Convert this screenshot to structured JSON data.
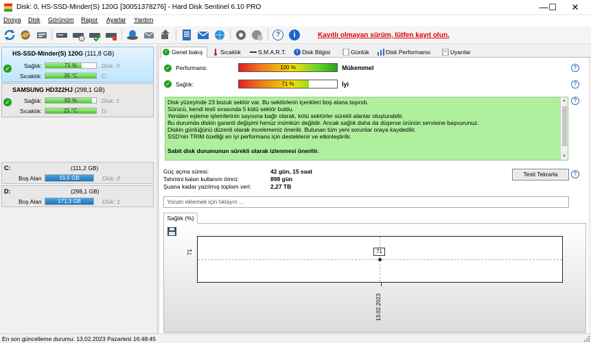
{
  "window": {
    "title": "Disk: 0, HS-SSD-Minder(S) 120G [30051378276]  -  Hard Disk Sentinel 6.10 PRO",
    "minimize": "—",
    "maximize": "☐",
    "close": "✕"
  },
  "menu": [
    "Dosya",
    "Disk",
    "Görünüm",
    "Rapor",
    "Ayarlar",
    "Yardım"
  ],
  "toolbar": {
    "unregistered_text": "Kayıtlı olmayan sürüm, lütfen kayıt olun.",
    "icons": [
      "refresh-icon",
      "refresh-all-icon",
      "disk-info-icon",
      "disk-test-icon",
      "surface-test-icon",
      "check-test-icon",
      "disk-check-icon",
      "report-icon",
      "send-report-icon",
      "tools-icon",
      "save-icon",
      "document-icon",
      "email-icon",
      "web-icon",
      "settings-icon",
      "alert-settings-icon",
      "help-icon",
      "info-icon"
    ]
  },
  "disks": [
    {
      "name": "HS-SSD-Minder(S) 120G",
      "size": "(111,8 GB)",
      "health_label": "Sağlık:",
      "health_value": "71 %",
      "health_fraction": 0.71,
      "temp_label": "Sıcaklık:",
      "temp_value": "36 °C",
      "disk_ref": "Disk: 0",
      "drive_ref": "C:"
    },
    {
      "name": "SAMSUNG HD322HJ",
      "size": "(298,1 GB)",
      "health_label": "Sağlık:",
      "health_value": "92 %",
      "health_fraction": 0.92,
      "temp_label": "Sıcaklık:",
      "temp_value": "21 °C",
      "disk_ref": "Disk: 1",
      "drive_ref": "D:"
    }
  ],
  "volumes": [
    {
      "letter": "C:",
      "size": "(111,2 GB)",
      "free_label": "Boş Alan",
      "free_value": "15,5 GB",
      "free_fraction": 0.14,
      "disk_ref": "Disk: 0"
    },
    {
      "letter": "D:",
      "size": "(298,1 GB)",
      "free_label": "Boş Alan",
      "free_value": "171,3 GB",
      "free_fraction": 0.57,
      "disk_ref": "Disk: 1"
    }
  ],
  "tabs": [
    "Genel bakış",
    "Sıcaklık",
    "S.M.A.R.T.",
    "Disk Bilgisi",
    "Günlük",
    "Disk Performansı",
    "Uyarılar"
  ],
  "overview": {
    "performance_label": "Performans:",
    "performance_value": "100 %",
    "performance_fraction": 1.0,
    "performance_word": "Mükemmel",
    "health_label": "Sağlık:",
    "health_value": "71 %",
    "health_fraction": 0.71,
    "health_word": "İyi",
    "message_lines": [
      "Disk yüzeyinde 23 bozuk sektör var. Bu sektörlerin içerikleri boş alana taşındı.",
      "Sürücü, kendi testi sırasında 5 kötü sektör buldu.",
      "Yeniden eşleme işlemlerinin sayısına bağlı olarak, kötü sektörler sürekli alanlar oluşturabilir.",
      "Bu durumda diskin garanti değişimi henüz mümkün değildir. Ancak sağlık daha da düşerse ürünün servisine başvurunuz.",
      "Diskin günlüğünü düzenli olarak incelemeniz önerilir. Bulunan tüm yeni sorunlar oraya kaydedilir.",
      "SSD'nin TRIM özelliği en iyi performans için desteklenir ve etkinleştirilir.",
      "",
      "Sabit disk durumunun sürekli olarak izlenmesi önerilir."
    ],
    "power_on_label": "Güç açma süresi:",
    "power_on_value": "42 gün, 15 saat",
    "remaining_label": "Tahmini kalan kullanım ömrü:",
    "remaining_value": "898 gün",
    "written_label": "Şuana kadar yazılmış toplam veri:",
    "written_value": "2,27 TB",
    "retest_label": "Testi Tekrarla",
    "comment_placeholder": "Yorum eklemek için tıklayın ..."
  },
  "graph_tab": "Sağlık (%)",
  "chart_data": {
    "type": "line",
    "title": "Sağlık (%)",
    "x": [
      "13.02.2023"
    ],
    "series": [
      {
        "values": [
          71
        ]
      }
    ],
    "y_tick": "71",
    "point_label": "71",
    "grid": true
  },
  "status": {
    "text": "En son güncelleme durumu: 13.02.2023 Pazartesi 16:48:45"
  },
  "colors": {
    "accent": "#0078d7",
    "ok_green": "#24a024",
    "message_bg": "#b0ef9e",
    "unregistered_red": "#e00000",
    "volume_bar": "#1a74c2"
  }
}
